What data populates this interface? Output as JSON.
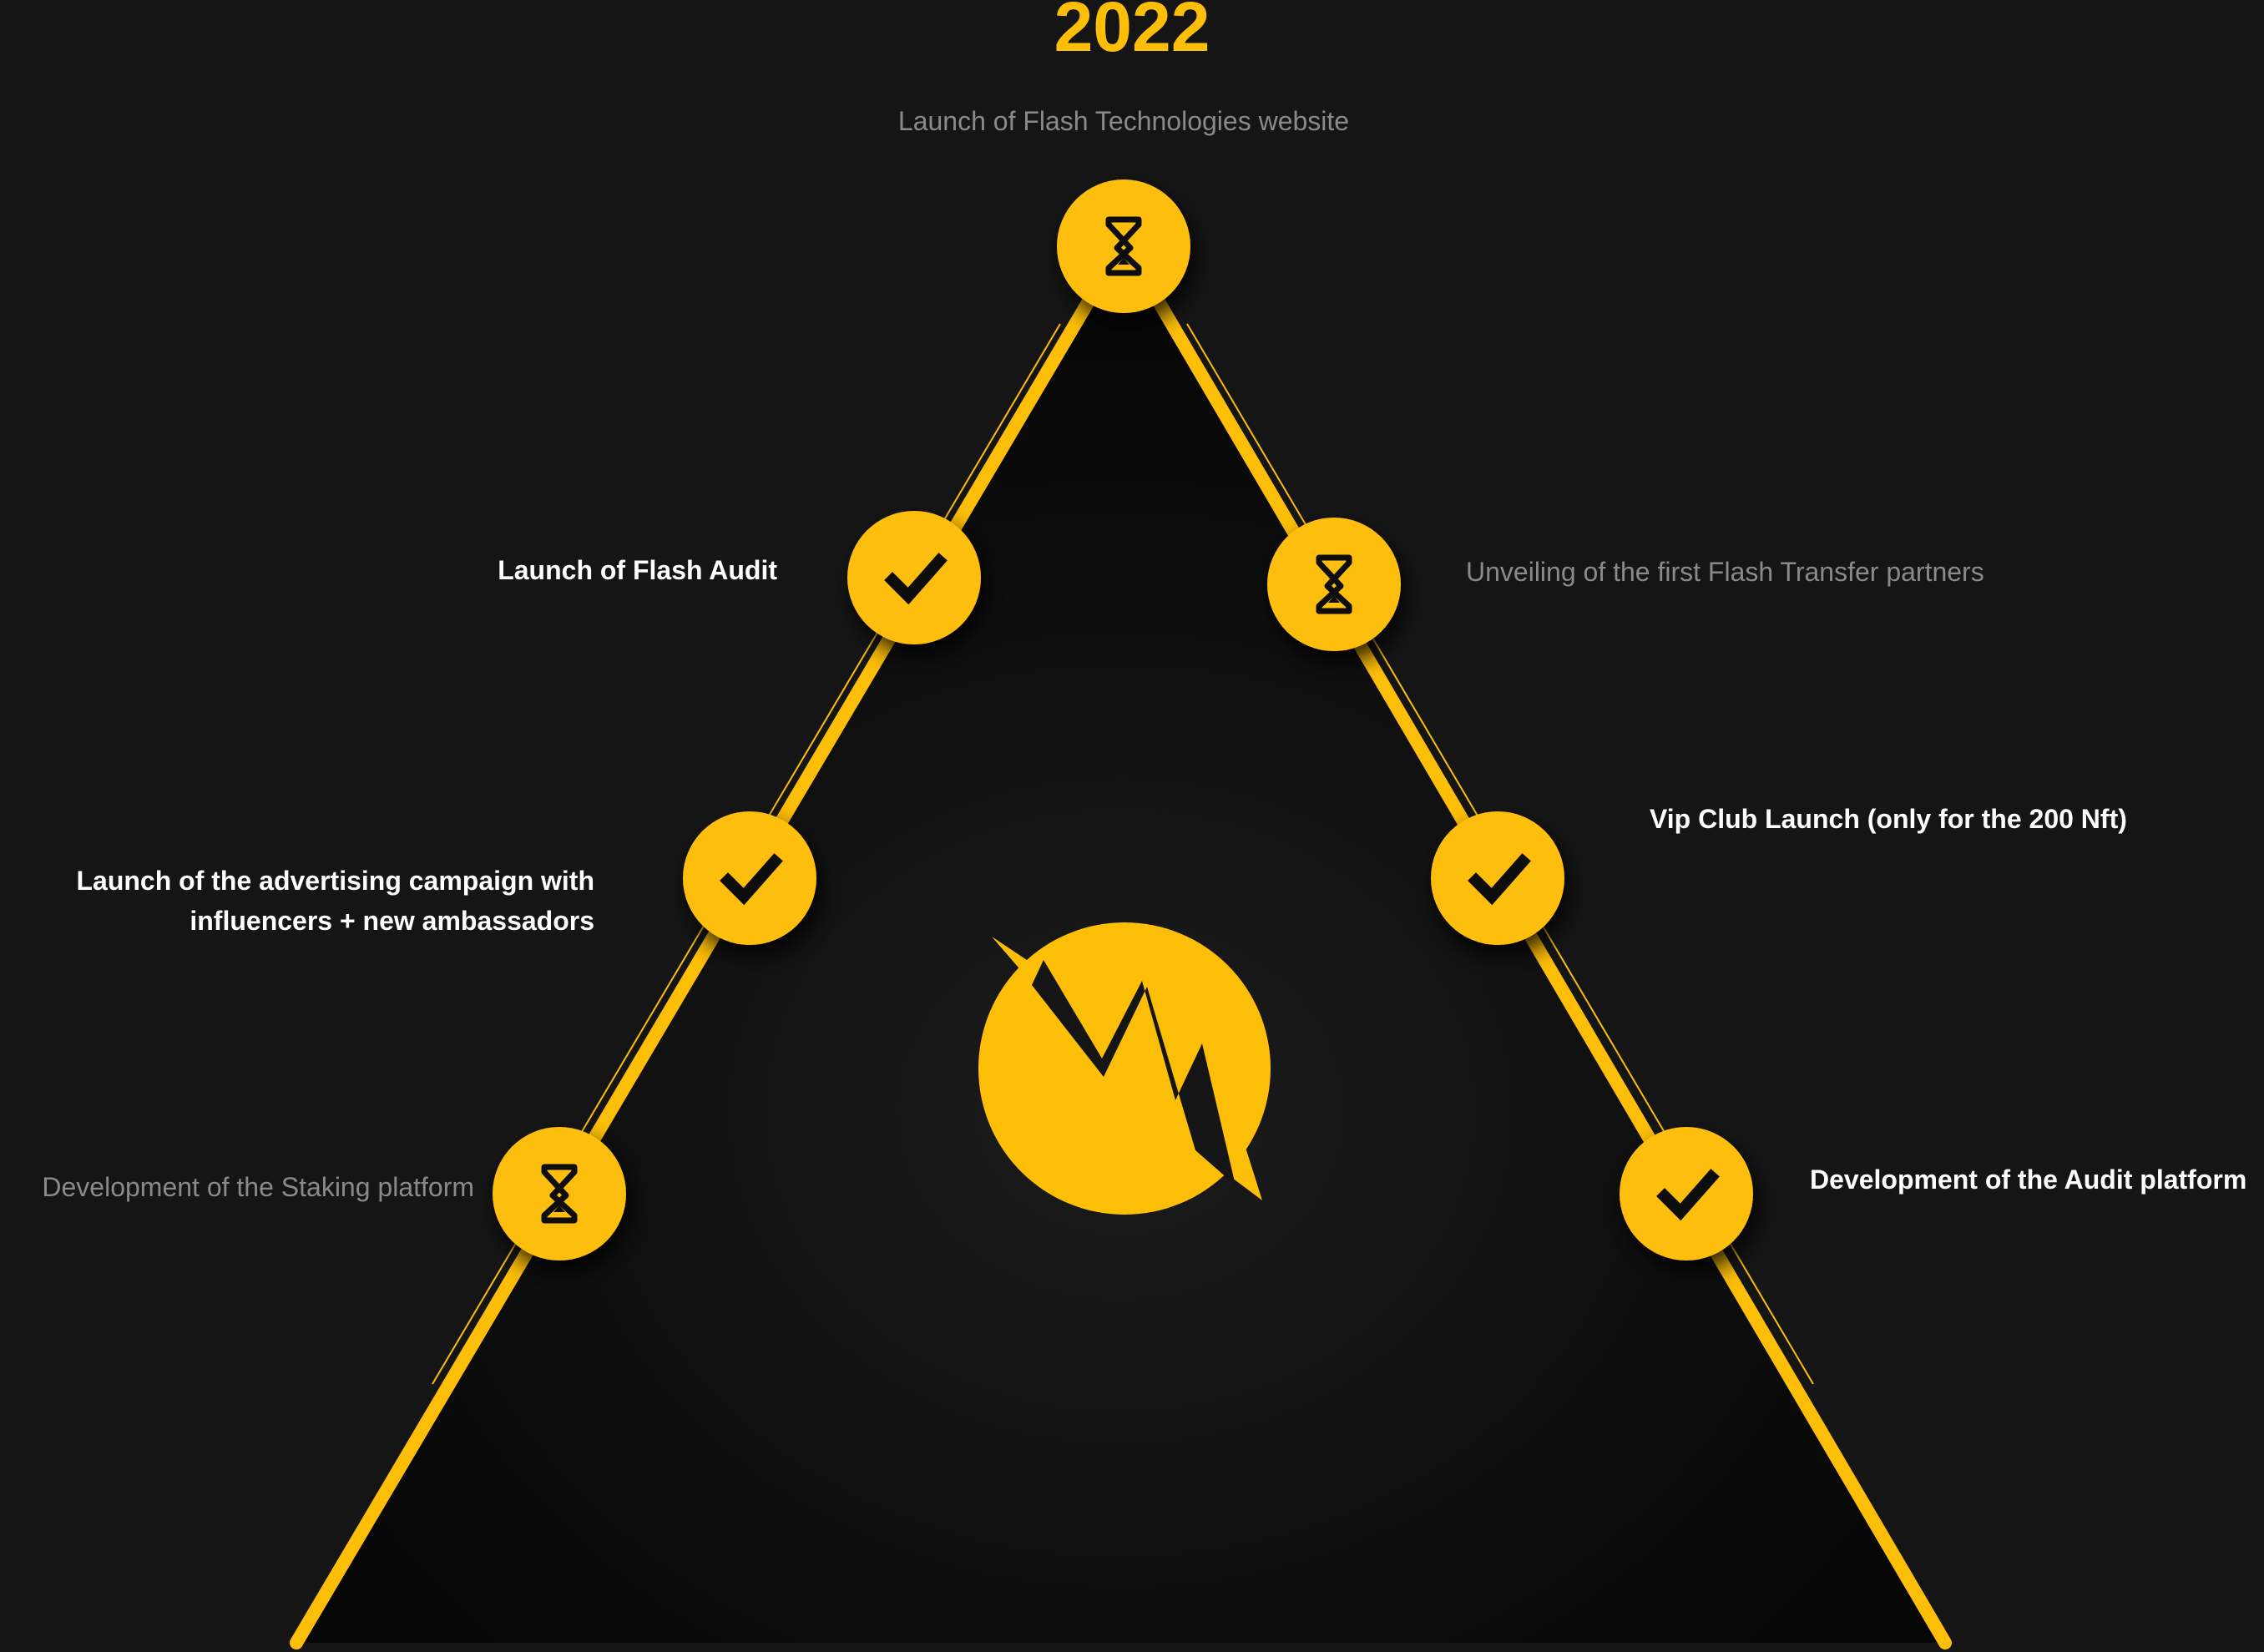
{
  "year": "2022",
  "accent_color": "#fdbe07",
  "milestones": [
    {
      "id": "top",
      "label": "Launch of Flash Technologies website",
      "status": "pending",
      "icon": "hourglass-icon"
    },
    {
      "id": "left-1",
      "label": "Launch of Flash Audit",
      "status": "done",
      "icon": "check-icon"
    },
    {
      "id": "left-2",
      "label_lines": [
        "Launch of the advertising campaign with",
        "influencers + new ambassadors"
      ],
      "status": "done",
      "icon": "check-icon"
    },
    {
      "id": "left-3",
      "label": "Development of the Staking platform",
      "status": "pending",
      "icon": "hourglass-icon"
    },
    {
      "id": "right-1",
      "label": "Unveiling of the first Flash Transfer partners",
      "status": "pending",
      "icon": "hourglass-icon"
    },
    {
      "id": "right-2",
      "label": "Vip Club Launch (only for the 200 Nft)",
      "status": "done",
      "icon": "check-icon"
    },
    {
      "id": "right-3",
      "label": "Development of the Audit platform",
      "status": "done",
      "icon": "check-icon"
    }
  ],
  "center_logo": "flash-logo-icon"
}
